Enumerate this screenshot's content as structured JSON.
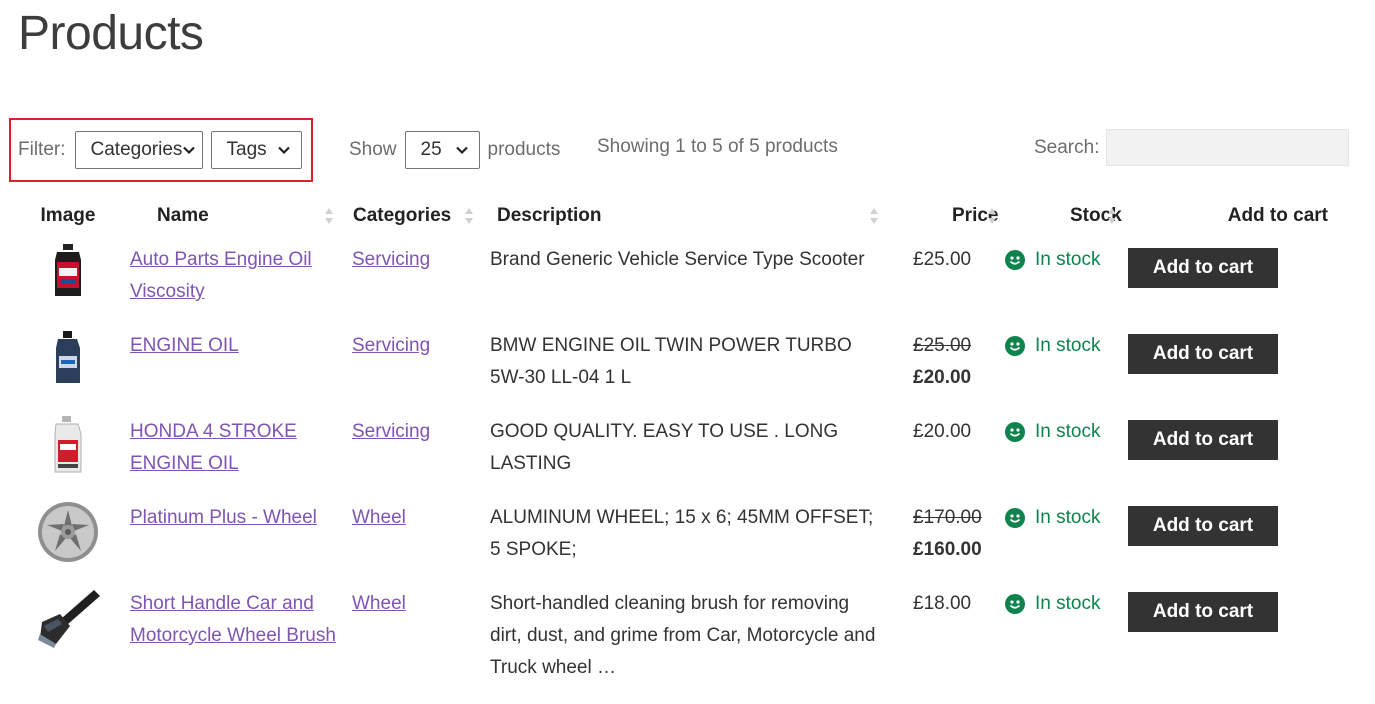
{
  "page": {
    "title": "Products"
  },
  "toolbar": {
    "filter_label": "Filter:",
    "categories_select": "Categories",
    "tags_select": "Tags",
    "show_label": "Show",
    "page_size": "25",
    "products_label": "products",
    "showing_info": "Showing 1 to 5 of 5 products",
    "search_label": "Search:",
    "search_value": ""
  },
  "table": {
    "headers": {
      "image": "Image",
      "name": "Name",
      "categories": "Categories",
      "description": "Description",
      "price": "Price",
      "stock": "Stock",
      "add_to_cart": "Add to cart"
    },
    "rows": [
      {
        "name": "Auto Parts Engine Oil Viscosity",
        "category": "Servicing",
        "description": "Brand Generic Vehicle Service Type Scooter",
        "price": "£25.00",
        "price_old": "",
        "stock": "In stock",
        "button": "Add to cart",
        "image_icon": "motor-oil-bottle-icon"
      },
      {
        "name": "ENGINE OIL",
        "category": "Servicing",
        "description": "BMW ENGINE OIL TWIN POWER TURBO 5W-30 LL-04 1 L",
        "price": "£20.00",
        "price_old": "£25.00",
        "stock": "In stock",
        "button": "Add to cart",
        "image_icon": "oil-bottle-icon"
      },
      {
        "name": "HONDA 4 STROKE ENGINE OIL",
        "category": "Servicing",
        "description": "GOOD QUALITY. EASY TO USE . LONG LASTING",
        "price": "£20.00",
        "price_old": "",
        "stock": "In stock",
        "button": "Add to cart",
        "image_icon": "oil-jug-icon"
      },
      {
        "name": "Platinum Plus - Wheel",
        "category": "Wheel",
        "description": "ALUMINUM WHEEL; 15 x 6; 45MM OFFSET; 5 SPOKE;",
        "price": "£160.00",
        "price_old": "£170.00",
        "stock": "In stock",
        "button": "Add to cart",
        "image_icon": "alloy-wheel-icon"
      },
      {
        "name": "Short Handle Car and Motorcycle Wheel Brush",
        "category": "Wheel",
        "description": "Short-handled cleaning brush for removing dirt, dust, and grime from Car, Motorcycle and Truck wheel …",
        "price": "£18.00",
        "price_old": "",
        "stock": "In stock",
        "button": "Add to cart",
        "image_icon": "wheel-brush-icon"
      }
    ]
  },
  "colors": {
    "link": "#7f54b3",
    "stock": "#0f834d",
    "button_bg": "#333333",
    "highlight": "#d9232e"
  }
}
